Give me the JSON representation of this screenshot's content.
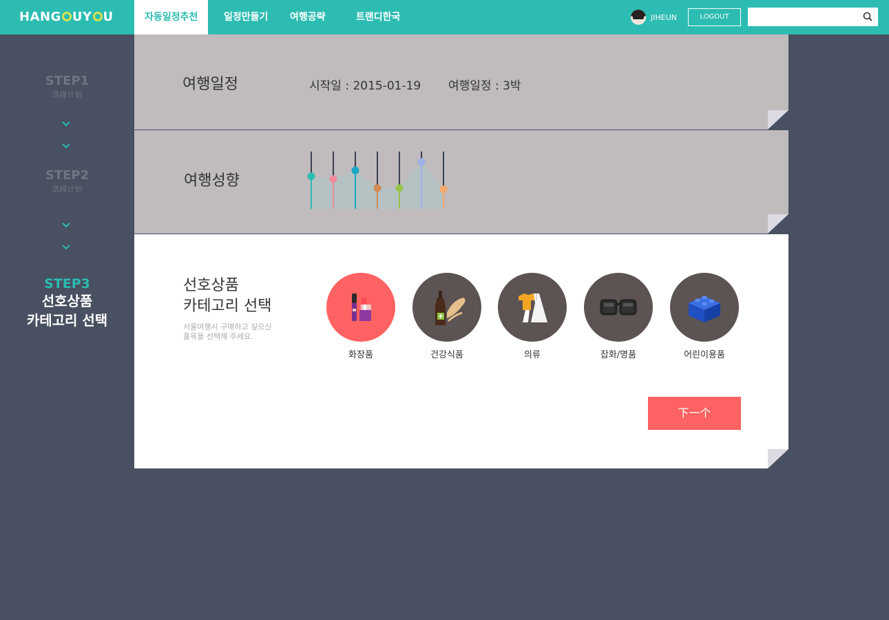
{
  "header": {
    "logo": {
      "parts": [
        "HANG",
        "UY",
        "U"
      ]
    },
    "nav": [
      {
        "label": "자동일정추천",
        "active": true
      },
      {
        "label": "일정만들기"
      },
      {
        "label": "여행공략"
      },
      {
        "label": "트랜디한국"
      }
    ],
    "user": {
      "name": "JIHEUN",
      "avatar_icon": "user-avatar"
    },
    "logout_label": "LOGOUT",
    "search": {
      "placeholder": "",
      "icon": "search-icon"
    },
    "colors": {
      "brand": "#2cbcb2",
      "logo_o": "#d6e24a"
    }
  },
  "sidebar": {
    "steps": [
      {
        "num": "STEP1",
        "sub": "选择计划"
      },
      {
        "num": "STEP2",
        "sub": "选择计划"
      },
      {
        "num": "STEP3",
        "sub_line1": "선호상품",
        "sub_line2": "카테고리 선택"
      }
    ],
    "chevron_icon": "chevron-down-icon"
  },
  "schedule_panel": {
    "title": "여행일정",
    "start": "시작일 : 2015-01-19",
    "length": "여행일정 : 3박"
  },
  "tendency_panel": {
    "title": "여행성향",
    "slider_colors": [
      "#2cbcb2",
      "#f08a9a",
      "#19a8c4",
      "#d08a52",
      "#98c24a",
      "#9fb0e8",
      "#f2a86a"
    ],
    "slider_levels": [
      0.57,
      0.52,
      0.67,
      0.36,
      0.36,
      0.82,
      0.34
    ]
  },
  "category_panel": {
    "title_line1": "선호상품",
    "title_line2": "카테고리 선택",
    "desc_line1": "서울여행시 구매하고 싶으신",
    "desc_line2": "품목을 선택해 주세요.",
    "categories": [
      {
        "label": "화장품",
        "icon": "lipstick-icon",
        "selected": true
      },
      {
        "label": "건강식품",
        "icon": "ginseng-bottle-icon"
      },
      {
        "label": "의류",
        "icon": "clothing-icon"
      },
      {
        "label": "잡화/명품",
        "icon": "sunglasses-icon"
      },
      {
        "label": "어린이용품",
        "icon": "toy-block-icon"
      }
    ],
    "next_label": "下一个",
    "accent": "#ff6262"
  }
}
